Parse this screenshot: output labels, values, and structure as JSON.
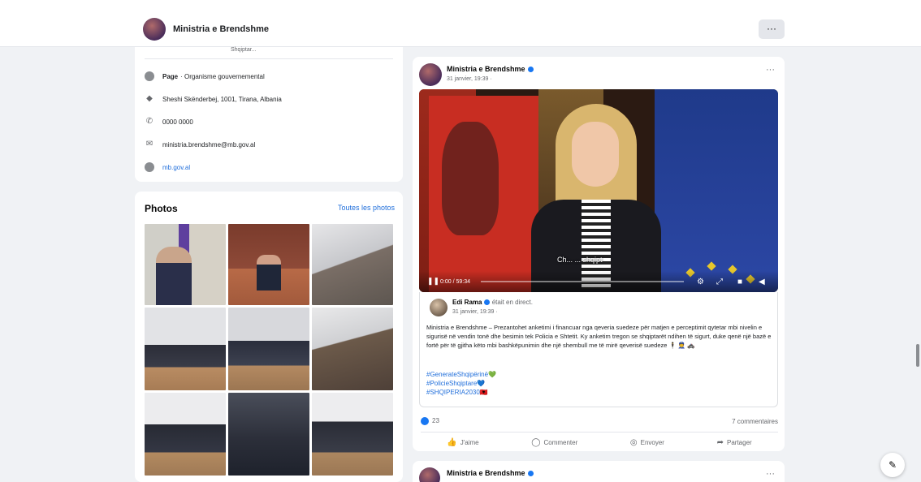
{
  "header": {
    "page_name": "Ministria e Brendshme",
    "more_label": "···"
  },
  "intro": {
    "cut_text": "Shqiptar...",
    "category_label": "Page",
    "category_value": "· Organisme gouvernemental",
    "address": "Sheshi Skënderbej, 1001, Tirana, Albania",
    "phone": "0000 0000",
    "email": "ministria.brendshme@mb.gov.al",
    "website": "mb.gov.al"
  },
  "photos": {
    "title": "Photos",
    "see_all": "Toutes les photos"
  },
  "post": {
    "author": "Ministria e Brendshme",
    "time": "31 janvier, 19:39 ·",
    "more_label": "···",
    "video": {
      "caption": "Ch... ... shqipt",
      "time": "0:00 / 59:34",
      "play_icon": "❚❚"
    },
    "shared": {
      "author": "Edi Rama",
      "live": "était en direct.",
      "time": "31 janvier, 19:39 ·",
      "text": "Ministria e Brendshme – Prezantohet anketimi i financuar nga qeveria suedeze për matjen e perceptimit qytetar mbi nivelin e sigurisë në vendin tonë dhe besimin tek Policia e Shtetit. Ky anketim tregon se shqiptarët ndihen të sigurt, duke qenë një bazë e fortë për të gjitha këto mbi bashkëpunimin dhe një shembull me të mirë qeverisë suedeze 🕴 👮 🚓",
      "tags": [
        "#GenerateShqipërinë💚",
        "#PolicieShqiptare💙",
        "#SHQIPERIA2030🇦🇱"
      ]
    },
    "likes": "23",
    "comments": "7 commentaires",
    "actions": {
      "like": "J'aime",
      "comment": "Commenter",
      "send": "Envoyer",
      "share": "Partager"
    }
  },
  "post2": {
    "author": "Ministria e Brendshme",
    "more_label": "···"
  },
  "colors": {
    "accent": "#1877f2",
    "link": "#216fdb",
    "background": "#f0f2f5"
  }
}
